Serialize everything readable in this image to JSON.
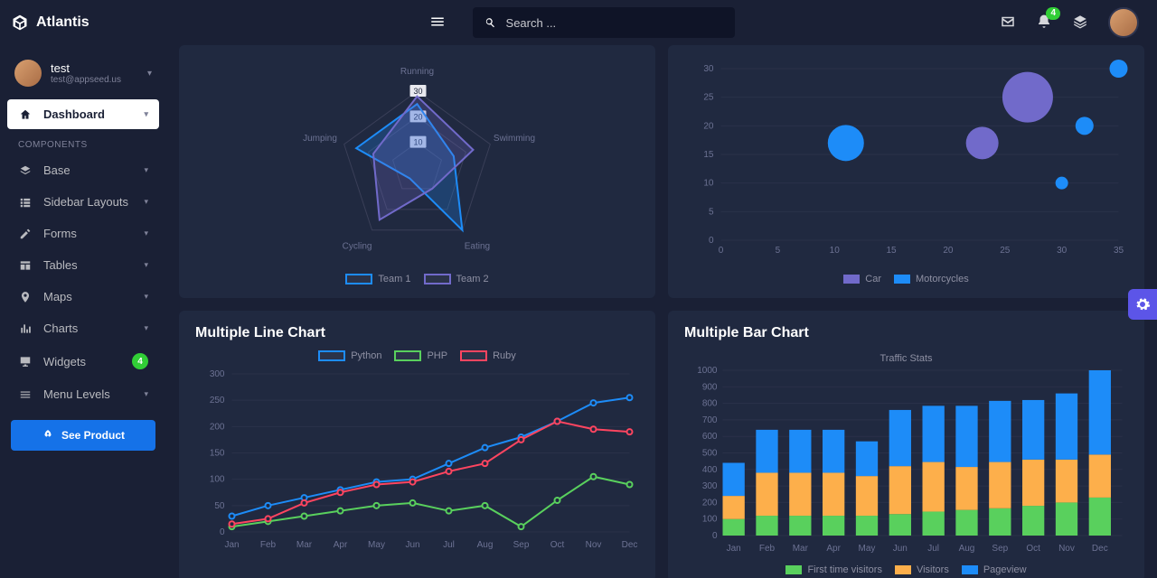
{
  "brand": "Atlantis",
  "search": {
    "placeholder": "Search ..."
  },
  "notifications": {
    "count": "4"
  },
  "user": {
    "name": "test",
    "email": "test@appseed.us"
  },
  "nav": {
    "dashboard": "Dashboard",
    "components_header": "COMPONENTS",
    "base": "Base",
    "sidebar_layouts": "Sidebar Layouts",
    "forms": "Forms",
    "tables": "Tables",
    "maps": "Maps",
    "charts": "Charts",
    "widgets": "Widgets",
    "widgets_badge": "4",
    "menu_levels": "Menu Levels",
    "see_product": "See Product"
  },
  "cards": {
    "line_title": "Multiple Line Chart",
    "bar_title": "Multiple Bar Chart"
  },
  "chart_data": [
    {
      "type": "radar",
      "axes": [
        "Running",
        "Swimming",
        "Eating",
        "Cycling",
        "Jumping"
      ],
      "series": [
        {
          "name": "Team 1",
          "values": [
            25,
            15,
            30,
            5,
            25
          ],
          "color": "#1d8cf8"
        },
        {
          "name": "Team 2",
          "values": [
            28,
            23,
            10,
            25,
            18
          ],
          "color": "#716aca"
        }
      ],
      "max": 30,
      "ticks": [
        30,
        20,
        10
      ]
    },
    {
      "type": "bubble",
      "xlim": [
        0,
        35
      ],
      "ylim": [
        0,
        30
      ],
      "xticks": [
        0,
        5,
        10,
        15,
        20,
        25,
        30,
        35
      ],
      "yticks": [
        0,
        5,
        10,
        15,
        20,
        25,
        30
      ],
      "series": [
        {
          "name": "Car",
          "color": "#716aca",
          "points": [
            {
              "x": 23,
              "y": 17,
              "r": 18
            },
            {
              "x": 27,
              "y": 25,
              "r": 28
            }
          ]
        },
        {
          "name": "Motorcycles",
          "color": "#1d8cf8",
          "points": [
            {
              "x": 11,
              "y": 17,
              "r": 20
            },
            {
              "x": 30,
              "y": 10,
              "r": 7
            },
            {
              "x": 32,
              "y": 20,
              "r": 10
            },
            {
              "x": 35,
              "y": 30,
              "r": 10
            }
          ]
        }
      ]
    },
    {
      "type": "line",
      "categories": [
        "Jan",
        "Feb",
        "Mar",
        "Apr",
        "May",
        "Jun",
        "Jul",
        "Aug",
        "Sep",
        "Oct",
        "Nov",
        "Dec"
      ],
      "ylim": [
        0,
        300
      ],
      "yticks": [
        0,
        50,
        100,
        150,
        200,
        250,
        300
      ],
      "series": [
        {
          "name": "Python",
          "color": "#1d8cf8",
          "values": [
            30,
            50,
            65,
            80,
            95,
            100,
            130,
            160,
            180,
            210,
            245,
            255
          ]
        },
        {
          "name": "PHP",
          "color": "#59d05d",
          "values": [
            10,
            20,
            30,
            40,
            50,
            55,
            40,
            50,
            10,
            60,
            105,
            90
          ]
        },
        {
          "name": "Ruby",
          "color": "#ff4560",
          "values": [
            15,
            25,
            55,
            75,
            90,
            95,
            115,
            130,
            175,
            210,
            195,
            190
          ]
        }
      ]
    },
    {
      "type": "bar",
      "title": "Traffic Stats",
      "categories": [
        "Jan",
        "Feb",
        "Mar",
        "Apr",
        "May",
        "Jun",
        "Jul",
        "Aug",
        "Sep",
        "Oct",
        "Nov",
        "Dec"
      ],
      "ylim": [
        0,
        1000
      ],
      "yticks": [
        0,
        100,
        200,
        300,
        400,
        500,
        600,
        700,
        800,
        900,
        1000
      ],
      "series": [
        {
          "name": "First time visitors",
          "color": "#59d05d",
          "values": [
            100,
            120,
            120,
            120,
            120,
            130,
            145,
            155,
            165,
            180,
            200,
            230
          ]
        },
        {
          "name": "Visitors",
          "color": "#fdaf4b",
          "values": [
            140,
            260,
            260,
            260,
            240,
            290,
            300,
            260,
            280,
            280,
            260,
            260
          ]
        },
        {
          "name": "Pageview",
          "color": "#1d8cf8",
          "values": [
            200,
            260,
            260,
            260,
            210,
            340,
            340,
            370,
            370,
            360,
            400,
            510
          ]
        }
      ]
    }
  ]
}
